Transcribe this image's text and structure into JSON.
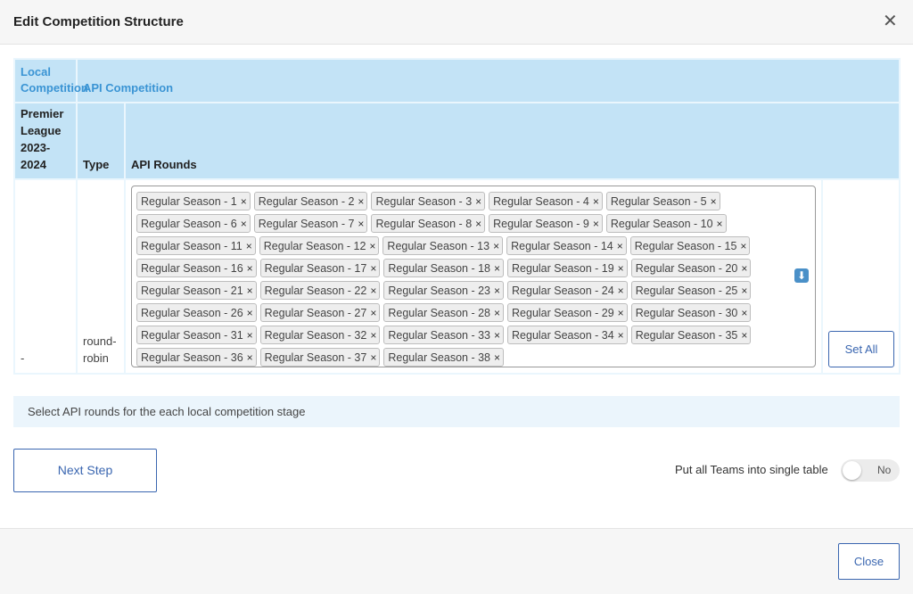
{
  "modal": {
    "title": "Edit Competition Structure"
  },
  "table": {
    "header1": {
      "local_competition": "Local Competition",
      "api_competition": "API Competition"
    },
    "header2": {
      "competition_name": "Premier League 2023-2024",
      "type": "Type",
      "api_rounds": "API Rounds"
    },
    "row": {
      "stage": "-",
      "type": "round-robin"
    }
  },
  "rounds": [
    "Regular Season - 1",
    "Regular Season - 2",
    "Regular Season - 3",
    "Regular Season - 4",
    "Regular Season - 5",
    "Regular Season - 6",
    "Regular Season - 7",
    "Regular Season - 8",
    "Regular Season - 9",
    "Regular Season - 10",
    "Regular Season - 11",
    "Regular Season - 12",
    "Regular Season - 13",
    "Regular Season - 14",
    "Regular Season - 15",
    "Regular Season - 16",
    "Regular Season - 17",
    "Regular Season - 18",
    "Regular Season - 19",
    "Regular Season - 20",
    "Regular Season - 21",
    "Regular Season - 22",
    "Regular Season - 23",
    "Regular Season - 24",
    "Regular Season - 25",
    "Regular Season - 26",
    "Regular Season - 27",
    "Regular Season - 28",
    "Regular Season - 29",
    "Regular Season - 30",
    "Regular Season - 31",
    "Regular Season - 32",
    "Regular Season - 33",
    "Regular Season - 34",
    "Regular Season - 35",
    "Regular Season - 36",
    "Regular Season - 37",
    "Regular Season - 38"
  ],
  "tag_remove_glyph": "×",
  "set_all_label": "Set All",
  "info_text": "Select API rounds for the each local competition stage",
  "next_step_label": "Next Step",
  "toggle": {
    "label": "Put all Teams into single table",
    "state": "No"
  },
  "close_label": "Close",
  "icons": {
    "close": "close-icon",
    "download": "down-arrow-icon"
  },
  "colors": {
    "header_bg": "#c3e3f6",
    "accent": "#3a66b0",
    "info_bg": "#ebf5fc"
  }
}
